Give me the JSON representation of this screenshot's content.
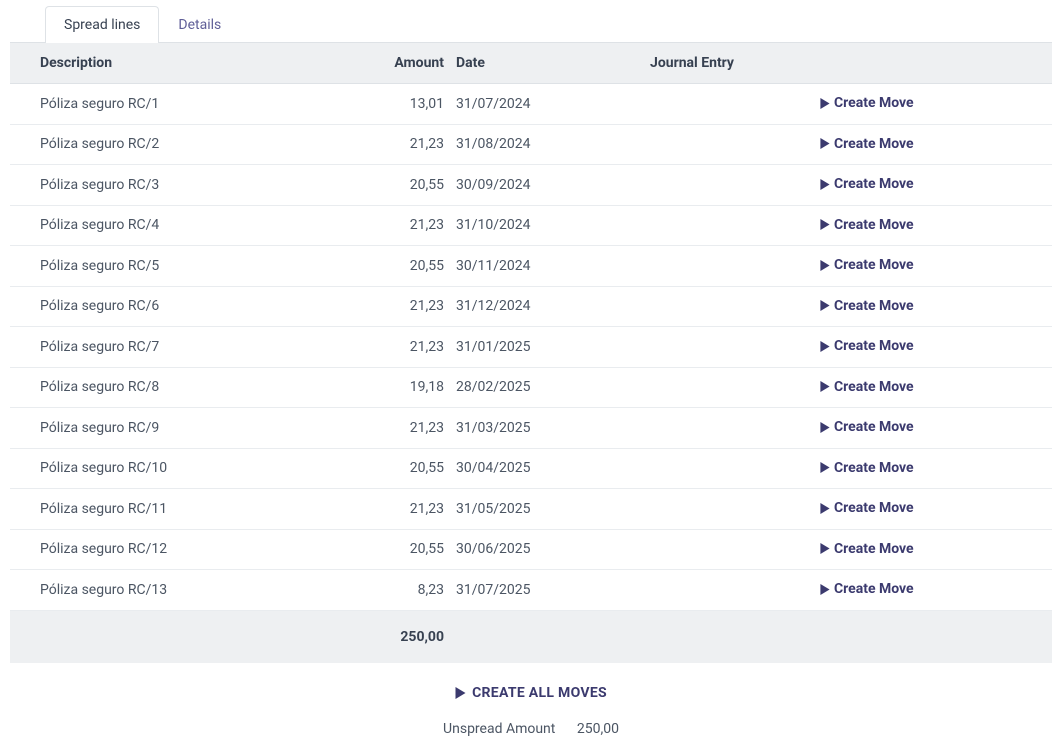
{
  "tabs": [
    {
      "label": "Spread lines",
      "active": true
    },
    {
      "label": "Details",
      "active": false
    }
  ],
  "table": {
    "headers": {
      "description": "Description",
      "amount": "Amount",
      "date": "Date",
      "journal_entry": "Journal Entry"
    },
    "rows": [
      {
        "description": "Póliza seguro RC/1",
        "amount": "13,01",
        "date": "31/07/2024",
        "journal_entry": ""
      },
      {
        "description": "Póliza seguro RC/2",
        "amount": "21,23",
        "date": "31/08/2024",
        "journal_entry": ""
      },
      {
        "description": "Póliza seguro RC/3",
        "amount": "20,55",
        "date": "30/09/2024",
        "journal_entry": ""
      },
      {
        "description": "Póliza seguro RC/4",
        "amount": "21,23",
        "date": "31/10/2024",
        "journal_entry": ""
      },
      {
        "description": "Póliza seguro RC/5",
        "amount": "20,55",
        "date": "30/11/2024",
        "journal_entry": ""
      },
      {
        "description": "Póliza seguro RC/6",
        "amount": "21,23",
        "date": "31/12/2024",
        "journal_entry": ""
      },
      {
        "description": "Póliza seguro RC/7",
        "amount": "21,23",
        "date": "31/01/2025",
        "journal_entry": ""
      },
      {
        "description": "Póliza seguro RC/8",
        "amount": "19,18",
        "date": "28/02/2025",
        "journal_entry": ""
      },
      {
        "description": "Póliza seguro RC/9",
        "amount": "21,23",
        "date": "31/03/2025",
        "journal_entry": ""
      },
      {
        "description": "Póliza seguro RC/10",
        "amount": "20,55",
        "date": "30/04/2025",
        "journal_entry": ""
      },
      {
        "description": "Póliza seguro RC/11",
        "amount": "21,23",
        "date": "31/05/2025",
        "journal_entry": ""
      },
      {
        "description": "Póliza seguro RC/12",
        "amount": "20,55",
        "date": "30/06/2025",
        "journal_entry": ""
      },
      {
        "description": "Póliza seguro RC/13",
        "amount": "8,23",
        "date": "31/07/2025",
        "journal_entry": ""
      }
    ],
    "row_action_label": "Create Move",
    "total_amount": "250,00"
  },
  "footer": {
    "create_all_label": "CREATE ALL MOVES",
    "unspread_label": "Unspread Amount",
    "unspread_value": "250,00"
  }
}
